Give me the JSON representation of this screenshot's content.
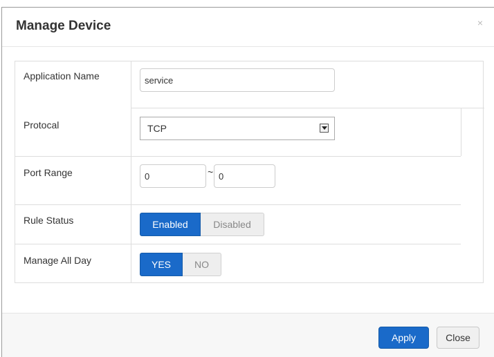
{
  "dialog": {
    "title": "Manage Device",
    "close_glyph": "×"
  },
  "form": {
    "application_name": {
      "label": "Application Name",
      "value": "service"
    },
    "protocol": {
      "label": "Protocal",
      "value": "TCP"
    },
    "port_range": {
      "label": "Port Range",
      "from": "0",
      "separator": "~",
      "to": "0"
    },
    "rule_status": {
      "label": "Rule Status",
      "enabled_label": "Enabled",
      "disabled_label": "Disabled",
      "selected": "Enabled"
    },
    "manage_all_day": {
      "label": "Manage All Day",
      "yes_label": "YES",
      "no_label": "NO",
      "selected": "YES"
    }
  },
  "footer": {
    "apply_label": "Apply",
    "close_label": "Close"
  },
  "colors": {
    "accent": "#1a6ac9",
    "inactive_segment": "#eeeeee",
    "footer_bg": "#f7f7f7"
  },
  "icons": {
    "close": "close-icon",
    "dropdown": "chevron-down-icon"
  }
}
